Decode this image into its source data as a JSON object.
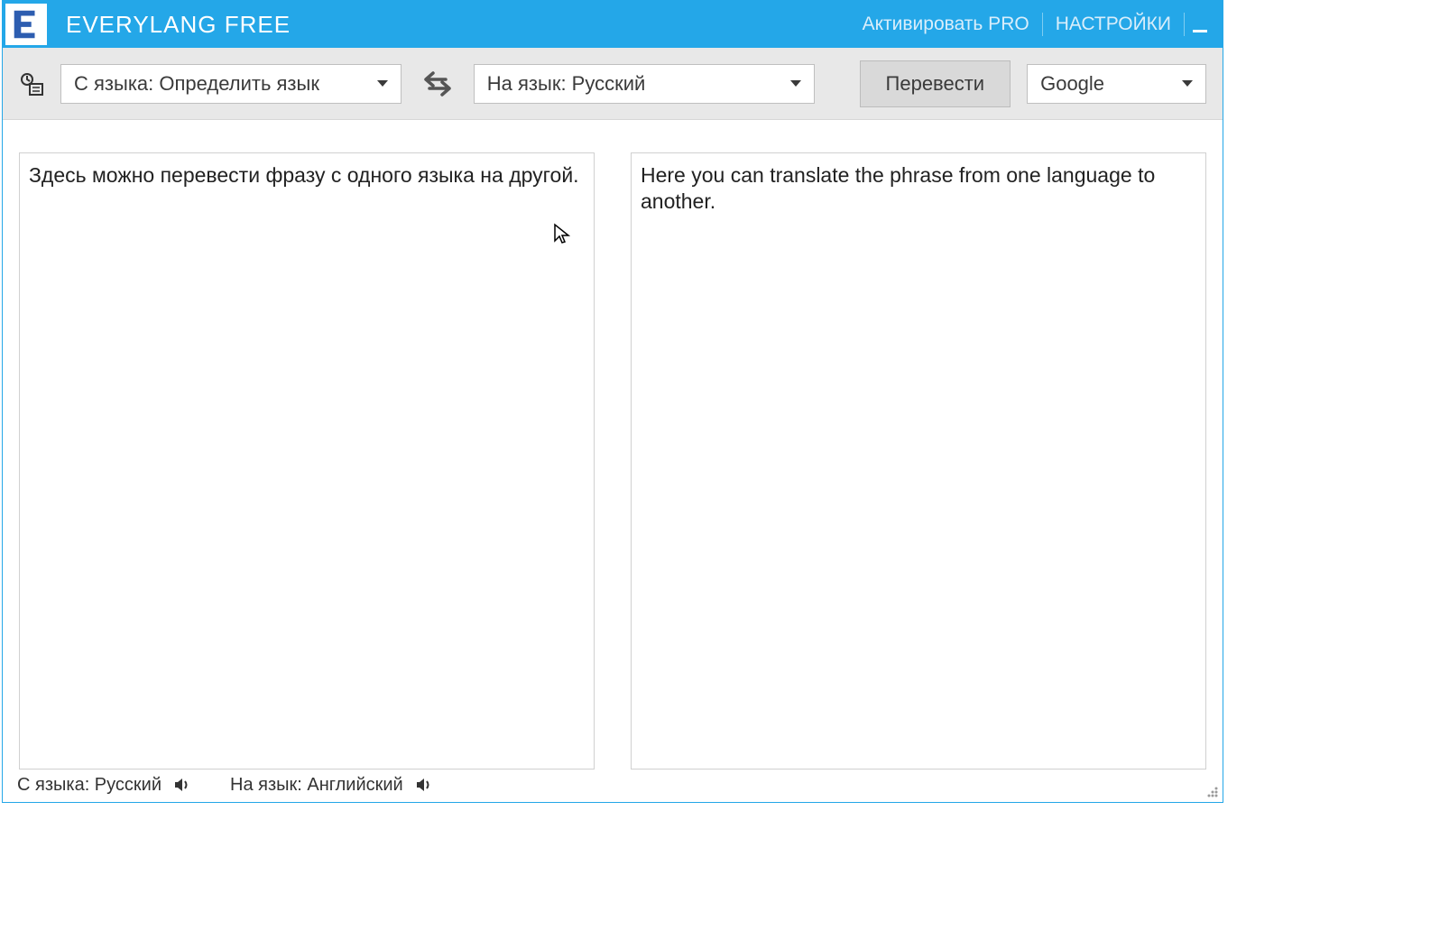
{
  "titlebar": {
    "app_title": "EVERYLANG FREE",
    "activate_pro": "Активировать PRO",
    "settings": "НАСТРОЙКИ"
  },
  "toolbar": {
    "from_lang_label": "С языка: Определить язык",
    "to_lang_label": "На язык: Русский",
    "translate_label": "Перевести",
    "engine_label": "Google"
  },
  "panes": {
    "source_text": "Здесь можно перевести фразу с одного языка на другой.",
    "target_text": "Here you can translate the phrase from one language to another."
  },
  "statusbar": {
    "from_label": "С языка: Русский",
    "to_label": "На язык: Английский"
  },
  "colors": {
    "accent": "#24a7e8"
  }
}
